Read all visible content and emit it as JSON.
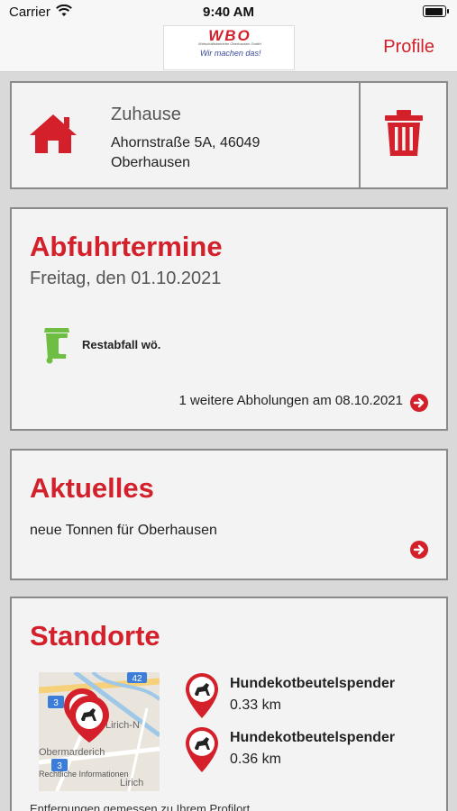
{
  "status_bar": {
    "carrier": "Carrier",
    "time": "9:40 AM"
  },
  "nav": {
    "logo_text": "WBO",
    "logo_subtitle": "Wirtschaftsbetriebe Oberhausen GmbH",
    "logo_slogan": "Wir machen das!",
    "profile_label": "Profile"
  },
  "address": {
    "name": "Zuhause",
    "street": "Ahornstraße 5A, 46049",
    "city": "Oberhausen",
    "icon": "home-icon",
    "delete_icon": "trash-icon"
  },
  "pickups": {
    "title": "Abfuhrtermine",
    "date": "Freitag, den 01.10.2021",
    "items": [
      {
        "label": "Restabfall wö.",
        "icon": "waste-bin-icon",
        "color": "#6fbe44"
      }
    ],
    "more_text": "1 weitere Abholungen am 08.10.2021"
  },
  "news": {
    "title": "Aktuelles",
    "items": [
      {
        "text": "neue Tonnen für Oberhausen"
      }
    ]
  },
  "locations": {
    "title": "Standorte",
    "map": {
      "labels": [
        "Lirich-N",
        "Obermarderich",
        "Lirich"
      ],
      "road_badges": [
        "42",
        "3",
        "3"
      ],
      "legal_text": "Rechtliche Informationen"
    },
    "items": [
      {
        "name": "Hundekotbeutelspender",
        "distance": "0.33 km"
      },
      {
        "name": "Hundekotbeutelspender",
        "distance": "0.36 km"
      }
    ],
    "footnote": "Entfernungen gemessen zu Ihrem Profilort"
  },
  "colors": {
    "accent": "#d3202a",
    "card_bg": "#f3f3f3",
    "page_bg": "#d9d9d9",
    "bin_green": "#6fbe44"
  }
}
